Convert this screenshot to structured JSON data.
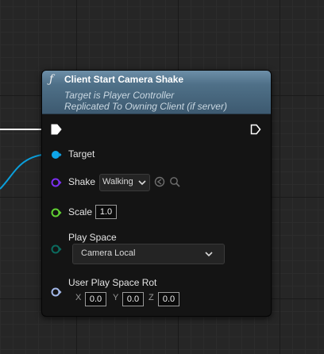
{
  "node": {
    "title": "Client Start Camera Shake",
    "subtitle_line1": "Target is Player Controller",
    "subtitle_line2": "Replicated To Owning Client (if server)",
    "function_icon": "function-f-icon"
  },
  "pins": {
    "target_label": "Target",
    "shake_label": "Shake",
    "shake_value": "Walking",
    "scale_label": "Scale",
    "scale_value": "1.0",
    "play_space_label": "Play Space",
    "play_space_value": "Camera Local",
    "rot_label": "User Play Space Rot",
    "rot_x_label": "X",
    "rot_x_value": "0.0",
    "rot_y_label": "Y",
    "rot_y_value": "0.0",
    "rot_z_label": "Z",
    "rot_z_value": "0.0"
  },
  "icons": {
    "exec_in": "exec-input-pin-icon",
    "exec_out": "exec-output-pin-icon",
    "use_selected": "use-selected-asset-icon",
    "browse": "browse-asset-icon",
    "dropdown": "chevron-down-icon"
  },
  "colors": {
    "header": "#4f7088",
    "object_pin": "#0ea5e9",
    "class_pin": "#7b2ff0",
    "float_pin": "#61d233",
    "enum_pin": "#0b6b5f",
    "struct_pin": "#a3b8e8",
    "exec_pin": "#ffffff"
  }
}
